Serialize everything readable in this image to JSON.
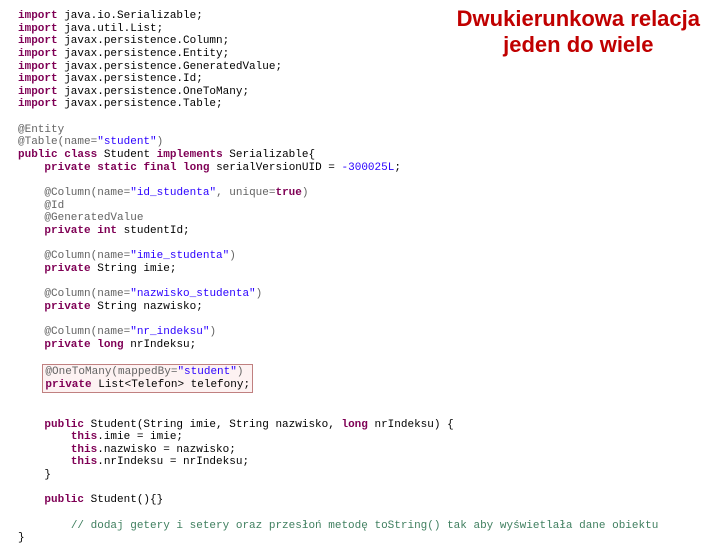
{
  "title_line1": "Dwukierunkowa relacja",
  "title_line2": "jeden do wiele",
  "code": {
    "import1_kw": "import",
    "import1_rest": " java.io.Serializable;",
    "import2_kw": "import",
    "import2_rest": " java.util.List;",
    "import3_kw": "import",
    "import3_rest": " javax.persistence.Column;",
    "import4_kw": "import",
    "import4_rest": " javax.persistence.Entity;",
    "import5_kw": "import",
    "import5_rest": " javax.persistence.GeneratedValue;",
    "import6_kw": "import",
    "import6_rest": " javax.persistence.Id;",
    "import7_kw": "import",
    "import7_rest": " javax.persistence.OneToMany;",
    "import8_kw": "import",
    "import8_rest": " javax.persistence.Table;",
    "ann_entity": "@Entity",
    "ann_table_pre": "@Table(name=",
    "ann_table_str": "\"student\"",
    "ann_table_post": ")",
    "class_public": "public",
    "class_class": "class",
    "class_name": " Student ",
    "class_implements": "implements",
    "class_serial": " Serializable{",
    "svuid_private": "private",
    "svuid_static": "static",
    "svuid_final": "final",
    "svuid_long": "long",
    "svuid_name": " serialVersionUID = ",
    "svuid_val": "-300025L",
    "svuid_semi": ";",
    "col1_pre": "@Column(name=",
    "col1_str": "\"id_studenta\"",
    "col1_mid": ", unique=",
    "col1_true": "true",
    "col1_post": ")",
    "ann_id": "@Id",
    "ann_gen": "@GeneratedValue",
    "f1_private": "private",
    "f1_int": "int",
    "f1_name": " studentId;",
    "col2_pre": "@Column(name=",
    "col2_str": "\"imie_studenta\"",
    "col2_post": ")",
    "f2_private": "private",
    "f2_type": " String imie;",
    "col3_pre": "@Column(name=",
    "col3_str": "\"nazwisko_studenta\"",
    "col3_post": ")",
    "f3_private": "private",
    "f3_type": " String nazwisko;",
    "col4_pre": "@Column(name=",
    "col4_str": "\"nr_indeksu\"",
    "col4_post": ")",
    "f4_private": "private",
    "f4_long": "long",
    "f4_name": " nrIndeksu;",
    "otm_pre": "@OneToMany(mappedBy=",
    "otm_str": "\"student\"",
    "otm_post": ")",
    "f5_private": "private",
    "f5_rest": " List<Telefon> telefony;",
    "ctor_public": "public",
    "ctor_sig": " Student(String imie, String nazwisko, ",
    "ctor_long": "long",
    "ctor_sig2": " nrIndeksu) {",
    "ctor_this1": "this",
    "ctor_b1": ".imie = imie;",
    "ctor_this2": "this",
    "ctor_b2": ".nazwisko = nazwisko;",
    "ctor_this3": "this",
    "ctor_b3": ".nrIndeksu = nrIndeksu;",
    "ctor_close": "}",
    "ctor2_public": "public",
    "ctor2_rest": " Student(){}",
    "comment": "// dodaj getery i setery oraz przesłoń metodę toString() tak aby wyświetlała dane obiektu",
    "class_close": "}"
  }
}
